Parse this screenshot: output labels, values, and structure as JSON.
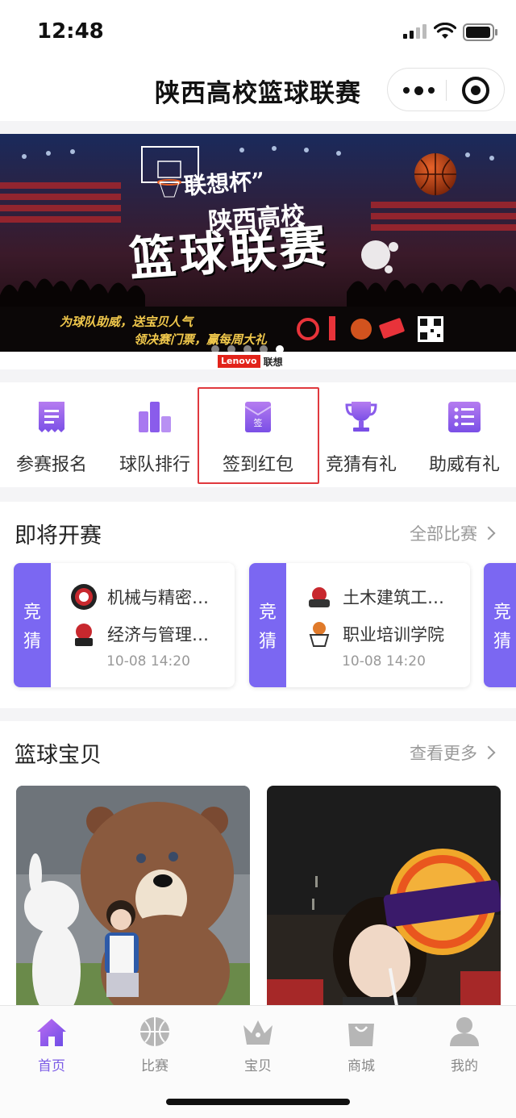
{
  "status": {
    "time": "12:48"
  },
  "navbar": {
    "title": "陕西高校篮球联赛"
  },
  "banner": {
    "cup": "联想杯”",
    "sub": "陕西高校",
    "title": "篮球联赛",
    "slogan1": "为球队助威，送宝贝人气",
    "slogan2": "领决赛门票，赢每周大礼",
    "brand_en": "Lenovo",
    "brand_cn": "联想"
  },
  "menu": {
    "items": [
      {
        "label": "参赛报名",
        "icon": "signup-icon"
      },
      {
        "label": "球队排行",
        "icon": "ranking-icon"
      },
      {
        "label": "签到红包",
        "icon": "red-envelope-icon",
        "icon_text": "签"
      },
      {
        "label": "竞猜有礼",
        "icon": "trophy-icon"
      },
      {
        "label": "助威有礼",
        "icon": "list-icon"
      }
    ]
  },
  "upcoming": {
    "title": "即将开赛",
    "more": "全部比赛",
    "guess_label": [
      "竞",
      "猜"
    ],
    "matches": [
      {
        "team1": "机械与精密…",
        "team2": "经济与管理…",
        "time": "10-08 14:20"
      },
      {
        "team1": "土木建筑工…",
        "team2": "职业培训学院",
        "time": "10-08 14:20"
      }
    ]
  },
  "babes": {
    "title": "篮球宝贝",
    "more": "查看更多"
  },
  "tabbar": {
    "items": [
      {
        "label": "首页",
        "icon": "home-icon",
        "active": true
      },
      {
        "label": "比赛",
        "icon": "basketball-icon",
        "active": false
      },
      {
        "label": "宝贝",
        "icon": "crown-icon",
        "active": false
      },
      {
        "label": "商城",
        "icon": "shopping-bag-icon",
        "active": false
      },
      {
        "label": "我的",
        "icon": "user-icon",
        "active": false
      }
    ]
  },
  "colors": {
    "accent": "#7b5be6",
    "guess_bg": "#7b67f2",
    "highlight": "#e0393e"
  }
}
